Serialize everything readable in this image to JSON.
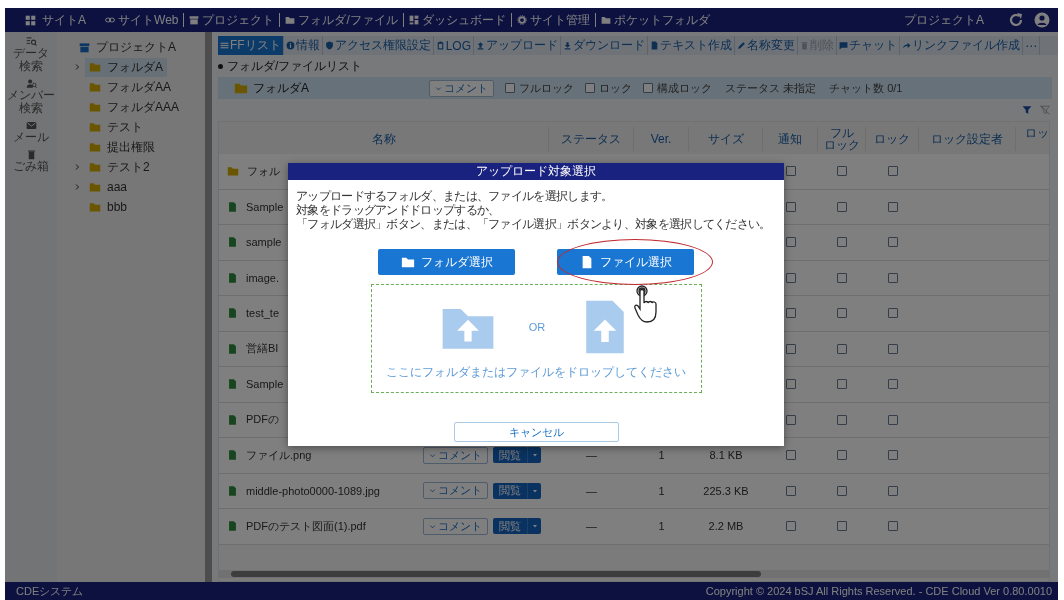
{
  "header": {
    "site": "サイトA",
    "nav": [
      {
        "label": "サイトWeb"
      },
      {
        "label": "プロジェクト"
      },
      {
        "label": "フォルダ/ファイル"
      },
      {
        "label": "ダッシュボード"
      },
      {
        "label": "サイト管理"
      },
      {
        "label": "ポケットフォルダ"
      }
    ],
    "project": "プロジェクトA"
  },
  "rail": [
    {
      "label": [
        "データ",
        "検索"
      ]
    },
    {
      "label": [
        "メンバー",
        "検索"
      ]
    },
    {
      "label": [
        "メール"
      ]
    },
    {
      "label": [
        "ごみ箱"
      ]
    }
  ],
  "tree": {
    "label": "プロジェクトA",
    "children": [
      {
        "label": "フォルダA",
        "selected": true,
        "expandable": true
      },
      {
        "label": "フォルダAA",
        "selected": false,
        "expandable": false
      },
      {
        "label": "フォルダAAA",
        "selected": false,
        "expandable": false
      },
      {
        "label": "テスト",
        "selected": false,
        "expandable": false
      },
      {
        "label": "提出権限",
        "selected": false,
        "expandable": false
      },
      {
        "label": "テスト2",
        "selected": false,
        "expandable": true
      },
      {
        "label": "aaa",
        "selected": false,
        "expandable": true
      },
      {
        "label": "bbb",
        "selected": false,
        "expandable": false
      }
    ]
  },
  "toolbar": [
    {
      "label": "FFリスト",
      "selected": true,
      "disabled": false
    },
    {
      "label": "情報",
      "selected": false,
      "disabled": false
    },
    {
      "label": "アクセス権限設定",
      "selected": false,
      "disabled": false
    },
    {
      "label": "LOG",
      "selected": false,
      "disabled": false
    },
    {
      "label": "アップロード",
      "selected": false,
      "disabled": false
    },
    {
      "label": "ダウンロード",
      "selected": false,
      "disabled": false
    },
    {
      "label": "テキスト作成",
      "selected": false,
      "disabled": false
    },
    {
      "label": "名称変更",
      "selected": false,
      "disabled": false
    },
    {
      "label": "削除",
      "selected": false,
      "disabled": true
    },
    {
      "label": "チャット",
      "selected": false,
      "disabled": false
    },
    {
      "label": "リンクファイル作成",
      "selected": false,
      "disabled": false
    },
    {
      "label": "⋯",
      "selected": false,
      "disabled": false
    }
  ],
  "section_title": "フォルダ/ファイルリスト",
  "folder_bar": {
    "name": "フォルダA",
    "comment": "コメント",
    "locks": [
      {
        "label": "フルロック",
        "checked": false
      },
      {
        "label": "ロック",
        "checked": false
      },
      {
        "label": "構成ロック",
        "checked": false
      }
    ],
    "status": "ステータス 未指定",
    "chat_count": "チャット数 0/1"
  },
  "table": {
    "columns": [
      [
        "名称"
      ],
      [
        "ステータス"
      ],
      [
        "Ver."
      ],
      [
        "サイズ"
      ],
      [
        "通知"
      ],
      [
        "フル",
        "ロック"
      ],
      [
        "ロック"
      ],
      [
        "ロック設定者"
      ],
      [
        "ロッ"
      ]
    ],
    "rows": [
      {
        "kind": "folder",
        "name": "フォル",
        "checks": [
          false,
          false,
          false
        ]
      },
      {
        "kind": "file",
        "name": "Sample",
        "checks": [
          false,
          false,
          false
        ]
      },
      {
        "kind": "file",
        "name": "sample",
        "checks": [
          false,
          false,
          false
        ]
      },
      {
        "kind": "file",
        "name": "image.",
        "checks": [
          false,
          false,
          false
        ]
      },
      {
        "kind": "file",
        "name": "test_te",
        "checks": [
          false,
          false,
          false
        ]
      },
      {
        "kind": "file",
        "name": "営繕BI",
        "checks": [
          false,
          false,
          false
        ]
      },
      {
        "kind": "file",
        "name": "Sample",
        "checks": [
          false,
          false,
          false
        ]
      },
      {
        "kind": "file",
        "name": "PDFの",
        "checks": [
          false,
          false,
          false
        ]
      },
      {
        "kind": "file",
        "name": "ファイル.png",
        "comment": "コメント",
        "view": "閲覧",
        "status": "—",
        "ver": "1",
        "size": "8.1 KB",
        "checks": [
          false,
          false,
          false
        ]
      },
      {
        "kind": "file",
        "name": "middle-photo0000-1089.jpg",
        "comment": "コメント",
        "view": "閲覧",
        "status": "—",
        "ver": "1",
        "size": "225.3 KB",
        "checks": [
          false,
          false,
          false
        ]
      },
      {
        "kind": "file",
        "name": "PDFのテスト図面(1).pdf",
        "comment": "コメント",
        "view": "閲覧",
        "status": "—",
        "ver": "1",
        "size": "2.2 MB",
        "checks": [
          false,
          false,
          false
        ]
      }
    ]
  },
  "footer": {
    "system": "CDEシステム",
    "copyright": "Copyright © 2024 bSJ All Rights Reserved. - CDE Cloud Ver 0.80.0010"
  },
  "modal": {
    "title": "アップロード対象選択",
    "message": [
      "アップロードするフォルダ、または、ファイルを選択します。",
      "対象をドラッグアンドドロップするか、",
      "「フォルダ選択」ボタン、または、「ファイル選択」ボタンより、対象を選択してください。"
    ],
    "folder_button": "フォルダ選択",
    "file_button": "ファイル選択",
    "or_label": "OR",
    "drop_hint": "ここにフォルダまたはファイルをドロップしてください",
    "cancel": "キャンセル"
  }
}
